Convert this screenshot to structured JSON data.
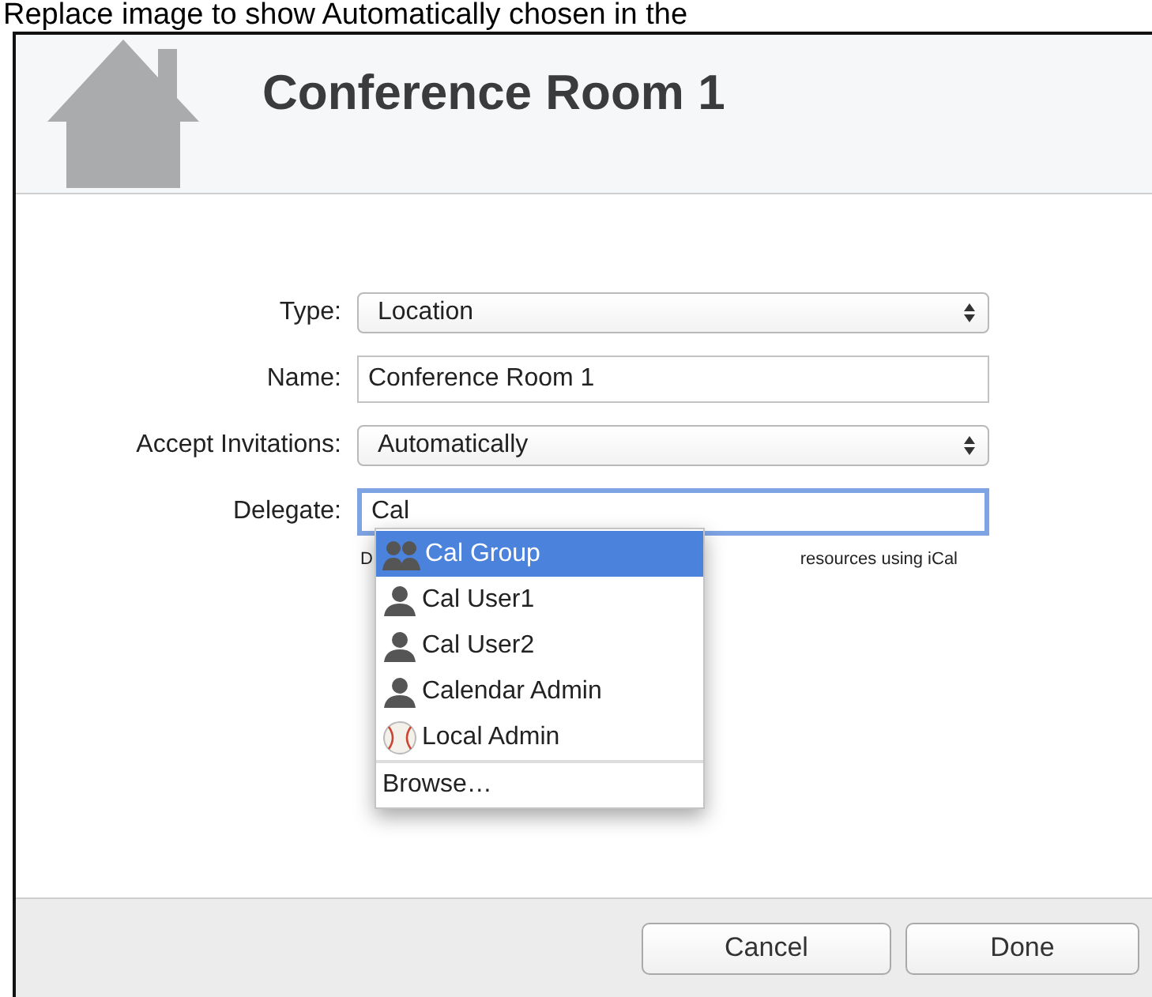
{
  "caption": "Replace image to show Automatically chosen in the",
  "header": {
    "title": "Conference Room 1"
  },
  "fields": [
    {
      "label": "Type:",
      "kind": "popup",
      "value": "Location",
      "focused": false
    },
    {
      "label": "Name:",
      "kind": "text",
      "value": "Conference Room 1",
      "focused": false
    },
    {
      "label": "Accept Invitations:",
      "kind": "popup",
      "value": "Automatically",
      "focused": false
    },
    {
      "label": "Delegate:",
      "kind": "text",
      "value": "Cal",
      "focused": true
    }
  ],
  "hint": {
    "start": "D",
    "end": "resources using iCal"
  },
  "suggestions": [
    {
      "label": "Cal Group",
      "kind": "group",
      "selected": true
    },
    {
      "label": "Cal User1",
      "kind": "user",
      "selected": false
    },
    {
      "label": "Cal User2",
      "kind": "user",
      "selected": false
    },
    {
      "label": "Calendar Admin",
      "kind": "user",
      "selected": false
    },
    {
      "label": "Local Admin",
      "kind": "baseball",
      "selected": false
    }
  ],
  "browse": "Browse…",
  "buttons": [
    "Cancel",
    "Done"
  ]
}
